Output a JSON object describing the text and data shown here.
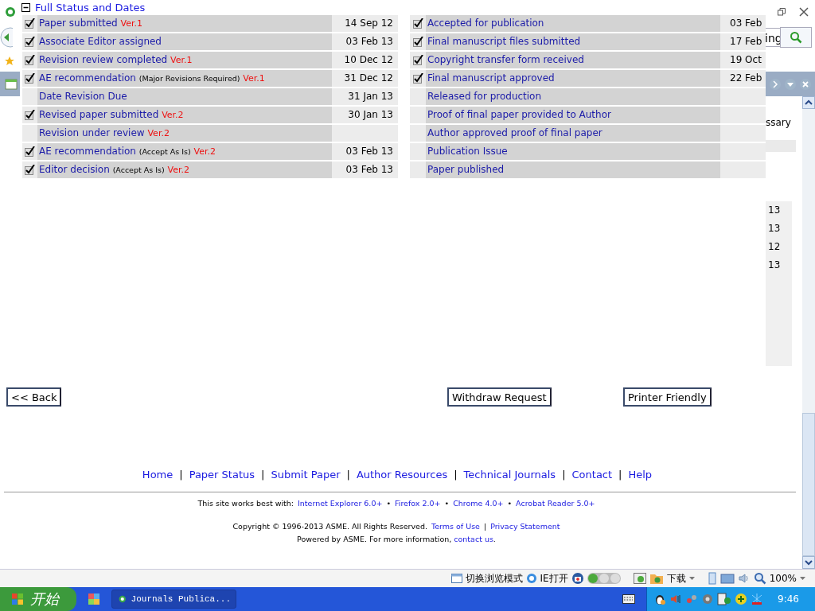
{
  "browser": {
    "search": {
      "value": "ing"
    }
  },
  "popup": {
    "title": "Full Status and Dates",
    "expanded": true
  },
  "status_left": [
    {
      "label": "Paper submitted",
      "version": "Ver.1",
      "date": "14 Sep 12",
      "checked": true
    },
    {
      "label": "Associate Editor assigned",
      "date": "03 Feb 13",
      "checked": true
    },
    {
      "label": "Revision review completed",
      "version": "Ver.1",
      "date": "10 Dec 12",
      "checked": true
    },
    {
      "label": "AE recommendation",
      "note": "(Major Revisions Required)",
      "version": "Ver.1",
      "date": "31 Dec 12",
      "checked": true
    },
    {
      "label": "Date Revision Due",
      "date": "31 Jan 13",
      "checked": false
    },
    {
      "label": "Revised paper submitted",
      "version": "Ver.2",
      "date": "30 Jan 13",
      "checked": true
    },
    {
      "label": "Revision under review",
      "version": "Ver.2",
      "checked": false
    },
    {
      "label": "AE recommendation",
      "note": "(Accept As Is)",
      "version": "Ver.2",
      "date": "03 Feb 13",
      "checked": true
    },
    {
      "label": "Editor decision",
      "note": "(Accept As Is)",
      "version": "Ver.2",
      "date": "03 Feb 13",
      "checked": true
    }
  ],
  "status_right": [
    {
      "label": "Accepted for publication",
      "date": "03 Feb",
      "checked": true
    },
    {
      "label": "Final manuscript files submitted",
      "date": "17 Feb",
      "checked": true
    },
    {
      "label": "Copyright transfer form received",
      "date": "19 Oct",
      "checked": true
    },
    {
      "label": "Final manuscript approved",
      "date": "22 Feb",
      "checked": true
    },
    {
      "label": "Released for production",
      "checked": false
    },
    {
      "label": "Proof of final paper provided to Author",
      "checked": false
    },
    {
      "label": "Author approved proof of final paper",
      "checked": false
    },
    {
      "label": "Publication Issue",
      "checked": false
    },
    {
      "label": "Paper published",
      "checked": false
    }
  ],
  "page": {
    "fragment_text": "ssary",
    "column_cells": [
      "13",
      "13",
      "12",
      "13"
    ]
  },
  "buttons": [
    {
      "label": "<< Back"
    },
    {
      "label": "Withdraw Request"
    },
    {
      "label": "Printer Friendly"
    }
  ],
  "nav_links": {
    "separator": "|",
    "items": [
      "Home",
      "Paper Status",
      "Submit Paper",
      "Author Resources",
      "Technical Journals",
      "Contact",
      "Help"
    ]
  },
  "footer": {
    "browsers_label": "This site works best with:",
    "bullet": "•",
    "browsers": [
      "Internet Explorer 6.0+",
      "Firefox 2.0+",
      "Chrome 4.0+",
      "Acrobat Reader 5.0+"
    ],
    "copyright": "Copyright © 1996-2013 ASME. All Rights Reserved.",
    "legal_links": [
      "Terms of Use",
      "Privacy Statement"
    ],
    "separator": "|",
    "powered": {
      "text": "Powered by ASME. For more information,",
      "link": "contact us",
      "after": "."
    }
  },
  "status_bar": {
    "mode_switch": "切换浏览模式",
    "open_in_ie": "IE打开",
    "download": "下载",
    "zoom": "100%"
  },
  "taskbar": {
    "start": "开始",
    "task": "Journals Publica...",
    "clock": "9:46"
  }
}
